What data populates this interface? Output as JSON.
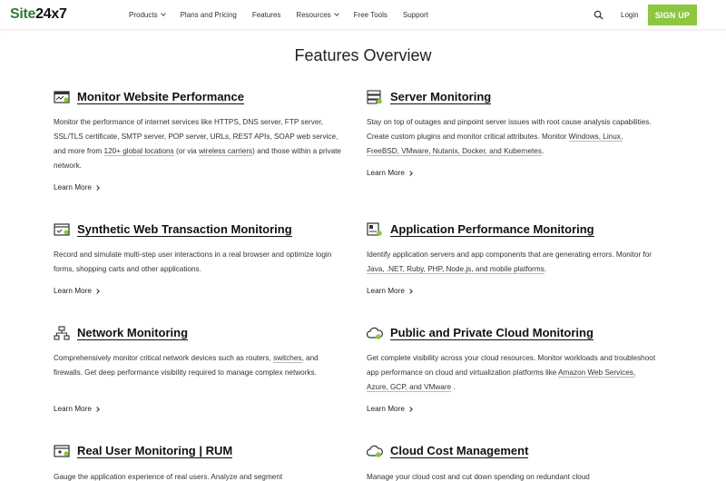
{
  "header": {
    "logo_prefix": "Site",
    "logo_suffix": "24x7",
    "nav": [
      {
        "label": "Products",
        "dropdown": true
      },
      {
        "label": "Plans and Pricing",
        "dropdown": false
      },
      {
        "label": "Features",
        "dropdown": false
      },
      {
        "label": "Resources",
        "dropdown": true
      },
      {
        "label": "Free Tools",
        "dropdown": false
      },
      {
        "label": "Support",
        "dropdown": false
      }
    ],
    "login_label": "Login",
    "signup_label": "SIGN UP",
    "signup_color": "#8dc63f"
  },
  "page_title": "Features Overview",
  "learn_more": "Learn More",
  "features": {
    "website": {
      "icon": "browser-monitor-icon",
      "title": "Monitor Website Performance",
      "desc_1": "Monitor the performance of internet services like HTTPS, DNS server, FTP server, SSL/TLS certificate, SMTP server, POP server, URLs, REST APIs, SOAP web service, and more from ",
      "desc_link_1": "120+ global locations",
      "desc_2": " (or via ",
      "desc_link_2": "wireless carriers",
      "desc_3": ") and those within a private network."
    },
    "server": {
      "icon": "server-icon",
      "title": "Server Monitoring",
      "desc_1": "Stay on top of outages and pinpoint server issues with root cause analysis capabilities. Create custom plugins and monitor critical attributes. Monitor ",
      "desc_link_1": "Windows, Linux, FreeBSD, VMware, Nutanix, Docker, and Kubernetes",
      "desc_2": "."
    },
    "synthetic": {
      "icon": "web-transaction-icon",
      "title": "Synthetic Web Transaction Monitoring",
      "desc_1": "Record and simulate multi-step user interactions in a real browser and optimize login forms, shopping carts and other applications."
    },
    "apm": {
      "icon": "application-icon",
      "title": "Application Performance Monitoring",
      "desc_1": "Identify application servers and app components that are generating errors. Monitor for ",
      "desc_link_1": "Java, .NET, Ruby, PHP, Node.js, and mobile platforms",
      "desc_2": "."
    },
    "network": {
      "icon": "network-icon",
      "title": "Network Monitoring",
      "desc_1": "Comprehensively monitor critical network devices such as routers, ",
      "desc_link_1": "switches",
      "desc_2": ", and firewalls. Get deep performance visibility required to manage complex networks."
    },
    "cloud": {
      "icon": "cloud-icon",
      "title": "Public and Private Cloud Monitoring",
      "desc_1": "Get complete visibility across your cloud resources. Monitor workloads and troubleshoot app performance on cloud and virtualization platforms like ",
      "desc_link_1": "Amazon Web Services, Azure, GCP, and VMware",
      "desc_2": " ."
    },
    "rum": {
      "icon": "real-user-icon",
      "title": "Real User Monitoring | RUM",
      "desc_1": "Gauge the application experience of real users. Analyze and segment"
    },
    "cost": {
      "icon": "cloud-cost-icon",
      "title": "Cloud Cost Management",
      "desc_1": "Manage your cloud cost and cut down spending on redundant cloud"
    }
  }
}
